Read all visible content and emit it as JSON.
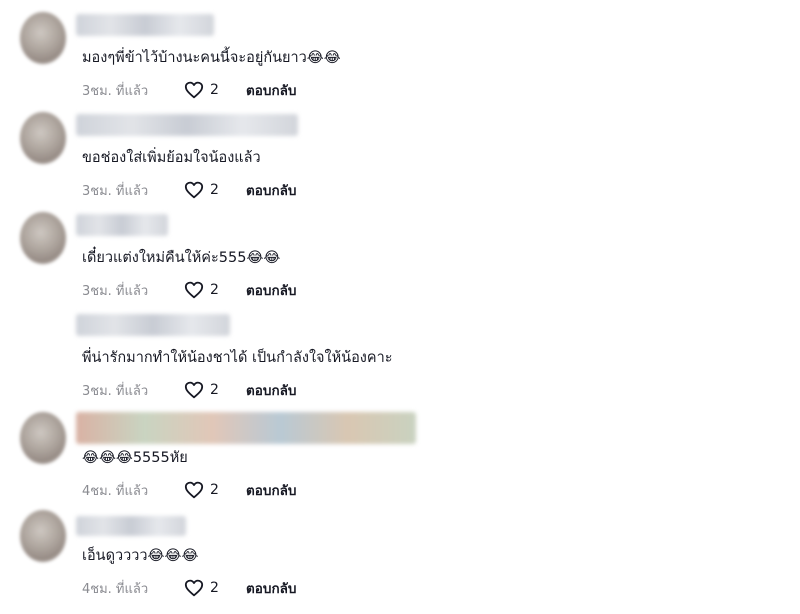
{
  "comments": [
    {
      "text": "มองๆพี่ข้าไว้บ้างนะคนนี้จะอยู่กันยาว😂😂",
      "time": "3ชม. ที่แล้ว",
      "likes": "2",
      "reply": "ตอบกลับ"
    },
    {
      "text": "ขอช่องใส่เพิ่มย้อมใจน้องแล้ว",
      "time": "3ชม. ที่แล้ว",
      "likes": "2",
      "reply": "ตอบกลับ"
    },
    {
      "text": "เดี๋ยวแต่งใหม่คืนให้ค่ะ555😂😂",
      "time": "3ชม. ที่แล้ว",
      "likes": "2",
      "reply": "ตอบกลับ"
    },
    {
      "text": "พี่น่ารักมากทำให้น้องชาได้ เป็นกำลังใจให้น้องคาะ",
      "time": "3ชม. ที่แล้ว",
      "likes": "2",
      "reply": "ตอบกลับ"
    },
    {
      "text": "😂😂😂5555หัย",
      "time": "4ชม. ที่แล้ว",
      "likes": "2",
      "reply": "ตอบกลับ"
    },
    {
      "text": "เอ็นดูวววว😂😂😂",
      "time": "4ชม. ที่แล้ว",
      "likes": "2",
      "reply": "ตอบกลับ"
    }
  ],
  "icons": {
    "like": "heart-outline-icon"
  },
  "colors": {
    "text": "#161823",
    "meta": "#8a8b91"
  }
}
